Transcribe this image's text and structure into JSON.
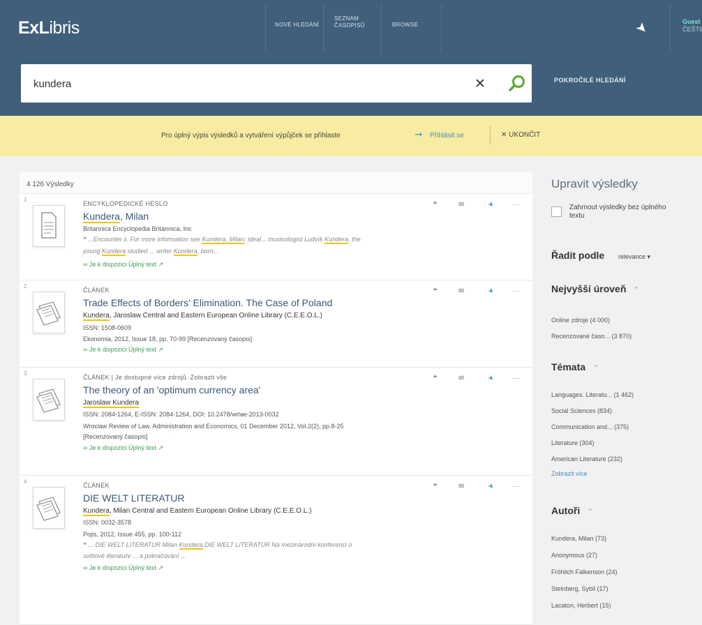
{
  "brand": {
    "part1": "ExL",
    "part2": "ibris"
  },
  "topnav": {
    "new_search": "NOVÉ HLEDÁNÍ",
    "journals_line1": "SEZNAM",
    "journals_line2": "ČASOPISŮ",
    "browse": "BROWSE"
  },
  "user": {
    "line1": "Guest",
    "line2": "ČEŠTINA"
  },
  "search": {
    "query": "kundera",
    "advanced": "POKROČILÉ HLEDÁNÍ"
  },
  "notice": {
    "text": "Pro úplný výpis výsledků a vytváření výpůjček se přihlaste",
    "login": "Přihlásit se",
    "dismiss": "UKONČIT"
  },
  "results_header": {
    "count": "4 126 Výsledky"
  },
  "results": [
    {
      "num": "1",
      "type": "ENCYKLOPEDICKÉ HESLO",
      "title_pre": "",
      "title_hl": "Kundera",
      "title_post": ", Milan",
      "line1": "Britannica Encyclopedia Britannica, Inc",
      "snip_a": "...Encounter ii. For more information see",
      "snip_hl1": "Kundera, Milan",
      "snip_b": "; ideal... musicologist Ludvík",
      "snip_hl2": "Kundera",
      "snip_c": ". the",
      "snip_d": "young",
      "snip_hl3": "Kundera",
      "snip_e": "studied ... writer",
      "snip_hl4": "Kundera",
      "snip_f": ", born...",
      "avail": "Je k dispozici  Úplný text"
    },
    {
      "num": "2",
      "type": "ČLÁNEK",
      "title_pre": "Trade Effects of Borders' Elimination. The Case of Poland",
      "author_hl": "Kundera",
      "author_post": ", Jaroslaw Central and Eastern European Online Library (C.E.E.O.L.)",
      "issn": "ISSN: 1508-0609",
      "source": "Ekonomia, 2012, Issue 18, pp. 70-99 [Recenzovaný časopis]",
      "avail": "Je k dispozici  Úplný text"
    },
    {
      "num": "3",
      "type": "ČLÁNEK | Je dostupné více zdrojů. Zobrazit vše",
      "title_pre": "The theory of an 'optimum currency area'",
      "author_hl": "Jaroslaw Kundera",
      "author_post": "",
      "issn": "ISSN: 2084-1264, E-ISSN: 2084-1264, DOI: 10.2478/wrlae-2013-0032",
      "source": "Wroclaw Review of Law, Administration and Economics, 01 December 2012, Vol.2(2), pp.8-25",
      "source2": "[Recenzovaný časopis]",
      "avail": "Je k dispozici  Úplný text"
    },
    {
      "num": "4",
      "type": "ČLÁNEK",
      "title_pre": "DIE WELT LITERATUR",
      "author_hl": "Kundera",
      "author_post": ", Milan Central and Eastern European Online Library (C.E.E.O.L.)",
      "issn": "ISSN: 0032-3578",
      "source": "Pojis, 2012, Issue 455, pp. 100-112",
      "snip_a": "... DIE WELT LITERATUR Milan",
      "snip_hl1": "Kundera",
      "snip_b": "DIE WELT LITERATUR Na mezinárodní konferenci o",
      "snip_c": "světové literatuře ... a pokračování ...",
      "avail": "Je k dispozici  Úplný text"
    }
  ],
  "sidebar": {
    "title": "Upravit výsledky",
    "checkbox_label": "Zahrnout výsledky bez úplného textu",
    "sort_label": "Řadit podle",
    "sort_value": "relevance ▾",
    "level_heading": "Nejvyšší úroveň",
    "level_items": [
      "Online zdroje (4 000)",
      "Recenzované časo... (3 870)"
    ],
    "topics_heading": "Témata",
    "topics_items": [
      "Languages. Literatu... (1 462)",
      "Social Sciences (834)",
      "Communication and... (375)",
      "Literature (304)",
      "American Literature (232)"
    ],
    "topics_more": "Zobrazit více",
    "authors_heading": "Autoři",
    "authors_items": [
      "Kundera, Milan (73)",
      "Anonymous (27)",
      "Fröhlich Falkenson (24)",
      "Steinberg, Sybil (17)",
      "Lacaton, Herbert (15)"
    ]
  }
}
